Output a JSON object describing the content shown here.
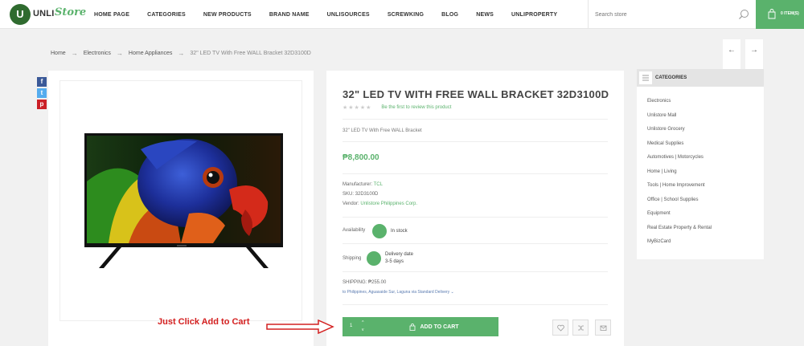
{
  "header": {
    "logo_mark": "U",
    "logo_unli": "UNLI",
    "logo_store": "Store",
    "nav": [
      "HOME PAGE",
      "CATEGORIES",
      "NEW PRODUCTS",
      "BRAND NAME",
      "UNLISOURCES",
      "SCREWKING",
      "BLOG",
      "NEWS",
      "UNLIPROPERTY"
    ],
    "search_placeholder": "Search store",
    "cart_label": "0 ITEM(S)"
  },
  "breadcrumb": [
    "Home",
    "Electronics",
    "Home Appliances",
    "32\" LED TV With Free WALL Bracket 32D3100D"
  ],
  "product": {
    "title": "32\" LED TV WITH FREE WALL BRACKET 32D3100D",
    "stars": "★★★★★",
    "review_link": "Be the first to review this product",
    "short_description": "32\" LED TV With Free WALL Bracket",
    "price": "₱8,800.00",
    "manufacturer_label": "Manufacturer:",
    "manufacturer": "TCL",
    "sku_label": "SKU:",
    "sku": "32D3100D",
    "vendor_label": "Vendor:",
    "vendor": "Unlistore Philippines Corp.",
    "availability_label": "Availability",
    "availability": "In stock",
    "shipping_label": "Shipping",
    "delivery_label": "Delivery date",
    "delivery_days": "3-5 days",
    "shipping_cost": "SHIPPING: ₱255.00",
    "shipping_to": "to Philippines, Aguasaide Sur, Laguna via Standard Delivery",
    "quantity": "1",
    "add_to_cart": "ADD TO CART"
  },
  "annotation": "Just Click Add to Cart",
  "categories": {
    "title": "CATEGORIES",
    "items": [
      "Electronics",
      "Unlistore Mall",
      "Unlistore Grocery",
      "Medical Supplies",
      "Automotives | Motorcycles",
      "Home | Living",
      "Tools | Home Improvement",
      "Office | School Supplies",
      "Equipment",
      "Real Estate Property & Rental",
      "MyBizCard"
    ]
  },
  "colors": {
    "accent": "#5ab26c",
    "annotation": "#d42020"
  },
  "icons": {
    "search": "search-icon",
    "cart": "cart-icon",
    "wishlist": "heart-icon",
    "compare": "compare-icon",
    "email": "envelope-icon"
  }
}
